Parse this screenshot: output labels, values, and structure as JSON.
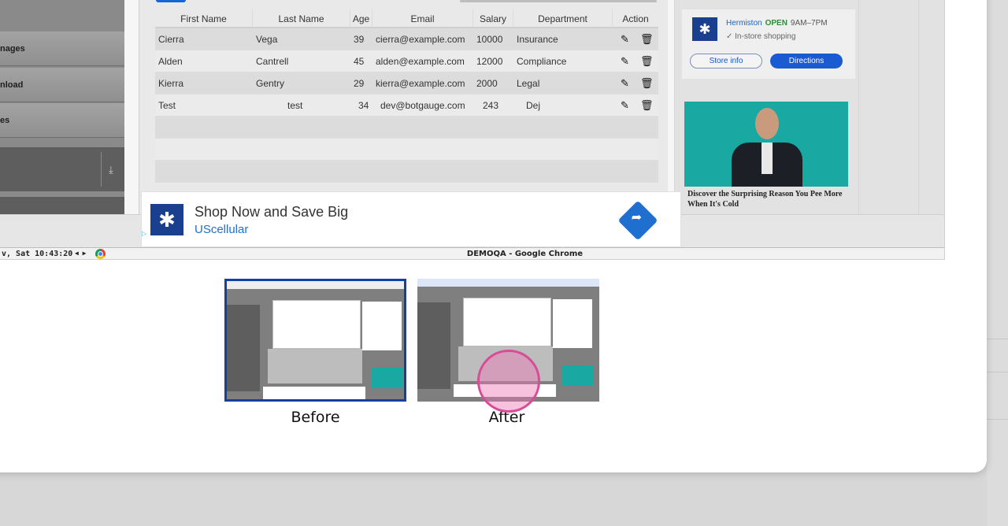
{
  "left_nav": {
    "items": [
      "nages",
      "nload",
      "es"
    ]
  },
  "table": {
    "headers": [
      "First Name",
      "Last Name",
      "Age",
      "Email",
      "Salary",
      "Department",
      "Action"
    ],
    "rows": [
      [
        "Cierra",
        "Vega",
        "39",
        "cierra@example.com",
        "10000",
        "Insurance"
      ],
      [
        "Alden",
        "Cantrell",
        "45",
        "alden@example.com",
        "12000",
        "Compliance"
      ],
      [
        "Kierra",
        "Gentry",
        "29",
        "kierra@example.com",
        "2000",
        "Legal"
      ],
      [
        "Test",
        "test",
        "34",
        "dev@botgauge.com",
        "243",
        "Dej"
      ]
    ]
  },
  "map_ad": {
    "place": "Hermiston",
    "status": "OPEN",
    "hours": "9AM–7PM",
    "service": "✓ In-store shopping",
    "store_info": "Store info",
    "directions": "Directions"
  },
  "side_ad": {
    "caption": "Discover the Surprising Reason You Pee More When It's Cold"
  },
  "banner": {
    "title": "Shop Now and Save Big",
    "brand": "UScellular"
  },
  "taskbar": {
    "clock": "v, Sat 10:43:20",
    "window_title": "DEMOQA - Google Chrome"
  },
  "thumbnails": {
    "before_label": "Before",
    "after_label": "After"
  },
  "colors": {
    "accent": "#1340a8",
    "click_marker": "#d84c96",
    "banner_blue": "#1f6fd1"
  },
  "icons": [
    "download-icon",
    "edit-icon",
    "trash-icon",
    "directions-arrow-icon",
    "star-logo-icon",
    "chrome-icon"
  ]
}
